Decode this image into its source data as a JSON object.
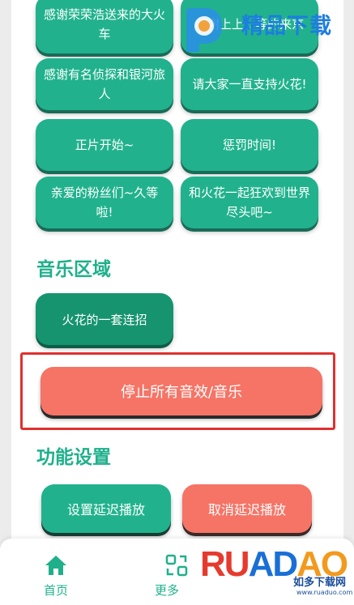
{
  "sound_buttons": [
    {
      "label": "感谢荣荣浩送来的大火车"
    },
    {
      "label": "感谢上上...等的来京"
    },
    {
      "label": "感谢有名侦探和银河旅人"
    },
    {
      "label": "请大家一直支持火花!"
    },
    {
      "label": "正片开始~"
    },
    {
      "label": "惩罚时间!"
    },
    {
      "label": "亲爱的粉丝们~久等啦!"
    },
    {
      "label": "和火花一起狂欢到世界尽头吧~"
    }
  ],
  "music_section": {
    "title": "音乐区域",
    "combo_button": "火花的一套连招"
  },
  "stop_all_button": "停止所有音效/音乐",
  "settings_section": {
    "title": "功能设置",
    "set_delay_button": "设置延迟播放",
    "cancel_delay_button": "取消延迟播放"
  },
  "bottom_nav": {
    "home_label": "首页",
    "more_label": "更多"
  },
  "watermark_top": {
    "text": "精品下载"
  },
  "watermark_bottom": {
    "brand": "RUADAO",
    "brand_r": "RU",
    "brand_ad": "AD",
    "brand_o": "AO",
    "cn_text": "如多下载网",
    "url": "www.ruaduo.com"
  },
  "colors": {
    "accent_green": "#21b28d",
    "dark_green": "#16946f",
    "coral": "#f57466",
    "highlight_red": "#e0302f"
  }
}
